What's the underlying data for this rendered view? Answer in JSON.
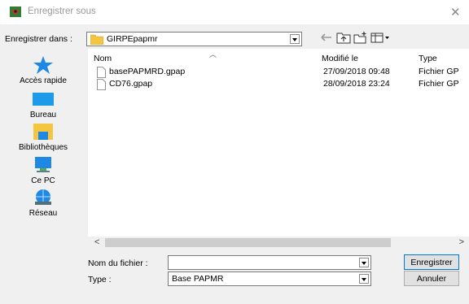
{
  "window": {
    "title": "Enregistrer sous",
    "close_glyph": "✕"
  },
  "save_in": {
    "label": "Enregistrer dans :",
    "value": "GIRPEpapmr"
  },
  "places": [
    {
      "label": "Accès rapide",
      "icon": "star-icon"
    },
    {
      "label": "Bureau",
      "icon": "desktop-icon"
    },
    {
      "label": "Bibliothèques",
      "icon": "libraries-icon"
    },
    {
      "label": "Ce PC",
      "icon": "computer-icon"
    },
    {
      "label": "Réseau",
      "icon": "network-icon"
    }
  ],
  "columns": {
    "name": "Nom",
    "modified": "Modifié le",
    "type": "Type"
  },
  "files": [
    {
      "name": "basePAPMRD.gpap",
      "modified": "27/09/2018 09:48",
      "type": "Fichier GP"
    },
    {
      "name": "CD76.gpap",
      "modified": "28/09/2018 23:24",
      "type": "Fichier GP"
    }
  ],
  "filename": {
    "label": "Nom du fichier :",
    "value": ""
  },
  "filetype": {
    "label": "Type :",
    "value": "Base PAPMR"
  },
  "buttons": {
    "save": "Enregistrer",
    "cancel": "Annuler"
  },
  "scroll": {
    "left": "<",
    "right": ">"
  },
  "colors": {
    "dialog_bg": "#f0f0f0",
    "accent": "#0078d7",
    "folder": "#f5c542"
  }
}
